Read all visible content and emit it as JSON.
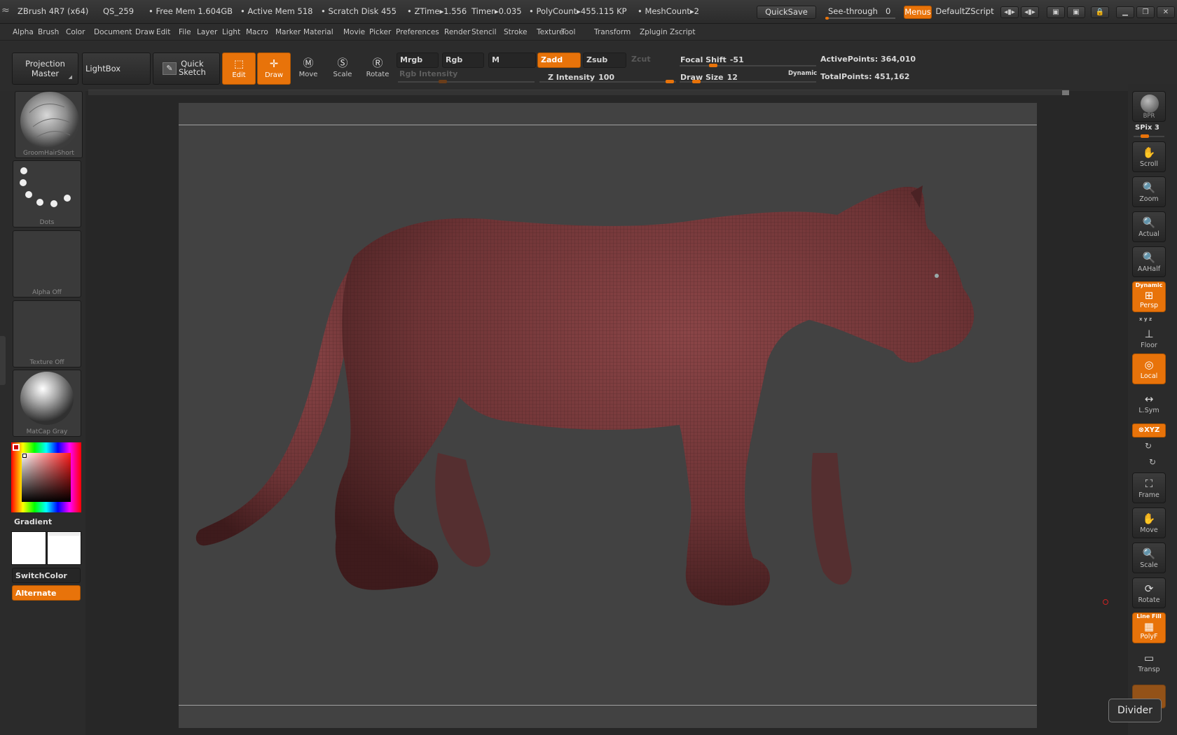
{
  "titlebar": {
    "app": "ZBrush 4R7 (x64)",
    "doc": "QS_259",
    "free_mem": "• Free Mem 1.604GB",
    "active_mem": "• Active Mem 518",
    "scratch": "• Scratch Disk 455",
    "ztime": "• ZTime▸1.556",
    "timer": "Timer▸0.035",
    "polycount": "• PolyCount▸455.115 KP",
    "meshcount": "• MeshCount▸2",
    "quicksave": "QuickSave",
    "see_through_label": "See-through",
    "see_through_value": "0",
    "see_through_fill": 0.05,
    "menus": "Menus",
    "script": "DefaultZScript"
  },
  "menu": [
    "Alpha",
    "Brush",
    "Color",
    "Document",
    "Draw",
    "Edit",
    "File",
    "Layer",
    "Light",
    "Macro",
    "Marker",
    "Material",
    "Movie",
    "Picker",
    "Preferences",
    "Render",
    "Stencil",
    "Stroke",
    "Texture",
    "Tool",
    "Transform",
    "Zplugin",
    "Zscript"
  ],
  "shelf": {
    "projection_master": [
      "Projection",
      "Master"
    ],
    "lightbox": "LightBox",
    "quick_sketch": [
      "Quick",
      "Sketch"
    ],
    "tools": [
      {
        "label": "Edit",
        "on": true,
        "icon": "edit-icon"
      },
      {
        "label": "Draw",
        "on": true,
        "icon": "draw-icon"
      },
      {
        "label": "Move",
        "on": false,
        "icon": "move-icon"
      },
      {
        "label": "Scale",
        "on": false,
        "icon": "scale-icon"
      },
      {
        "label": "Rotate",
        "on": false,
        "icon": "rotate-icon"
      }
    ],
    "mrgb": "Mrgb",
    "rgb": "Rgb",
    "m": "M",
    "zadd": "Zadd",
    "zsub": "Zsub",
    "zcut": "Zcut",
    "rgb_intensity": "Rgb Intensity",
    "z_intensity_label": "Z Intensity",
    "z_intensity_value": "100",
    "focal_shift_label": "Focal Shift",
    "focal_shift_value": "-51",
    "draw_size_label": "Draw Size",
    "draw_size_value": "12",
    "dynamic": "Dynamic",
    "active_points": "ActivePoints: 364,010",
    "total_points": "TotalPoints: 451,162"
  },
  "left": {
    "brush": "GroomHairShort",
    "stroke": "Dots",
    "alpha": "Alpha Off",
    "texture": "Texture Off",
    "material": "MatCap Gray",
    "gradient": "Gradient",
    "switch_color": "SwitchColor",
    "alternate": "Alternate"
  },
  "right": {
    "bpr": "BPR",
    "spix": "SPix 3",
    "scroll": "Scroll",
    "zoom": "Zoom",
    "actual": "Actual",
    "aahalf": "AAHalf",
    "persp_sup": "Dynamic",
    "persp": "Persp",
    "xyz_small": "x y z",
    "floor": "Floor",
    "local": "Local",
    "lsym": "L.Sym",
    "xyz": "⊗XYZ",
    "frame": "Frame",
    "move": "Move",
    "scale": "Scale",
    "rotate": "Rotate",
    "polyf_sup": "Line Fill",
    "polyf": "PolyF",
    "transp": "Transp"
  },
  "tooltip": "Divider",
  "colors": {
    "accent": "#e8730a",
    "model": "#7a3a3c",
    "canvas": "#424242"
  }
}
